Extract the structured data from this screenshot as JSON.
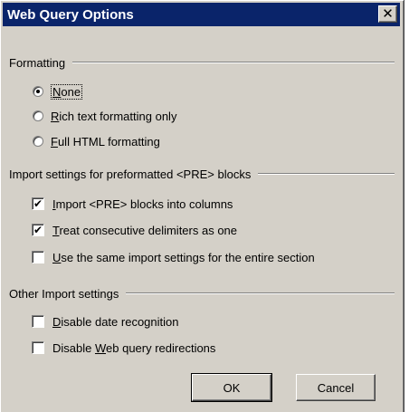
{
  "dialog": {
    "title": "Web Query Options",
    "close_icon": "close-icon"
  },
  "formatting": {
    "header": "Formatting",
    "options": [
      {
        "label": "None",
        "accesskey": "N",
        "checked": true
      },
      {
        "label": "Rich text formatting only",
        "accesskey": "R",
        "checked": false
      },
      {
        "label": "Full HTML formatting",
        "accesskey": "F",
        "checked": false
      }
    ]
  },
  "pre_settings": {
    "header": "Import settings for preformatted <PRE> blocks",
    "options": [
      {
        "label": "Import <PRE> blocks into columns",
        "accesskey": "I",
        "checked": true
      },
      {
        "label": "Treat consecutive delimiters as one",
        "accesskey": "T",
        "checked": true
      },
      {
        "label": "Use the same import settings for the entire section",
        "accesskey": "U",
        "checked": false
      }
    ]
  },
  "other_settings": {
    "header": "Other Import settings",
    "options": [
      {
        "label": "Disable date recognition",
        "accesskey": "D",
        "checked": false
      },
      {
        "label": "Disable Web query redirections",
        "accesskey": "W",
        "checked": false
      }
    ]
  },
  "buttons": {
    "ok": "OK",
    "cancel": "Cancel"
  }
}
